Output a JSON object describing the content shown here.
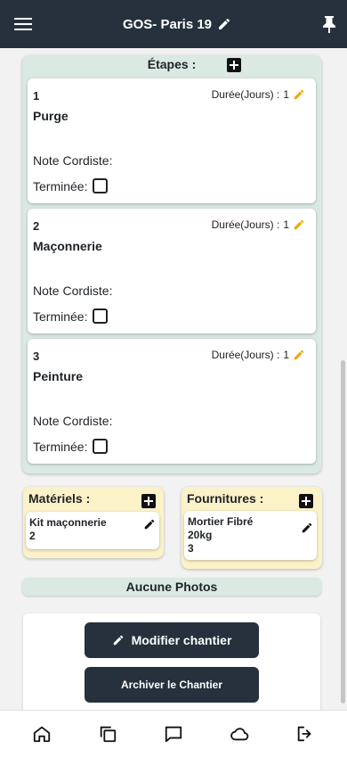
{
  "header": {
    "title": "GOS- Paris 19"
  },
  "etapes": {
    "title": "Étapes :",
    "duration_label": "Durée(Jours) :",
    "note_label": "Note Cordiste:",
    "done_label": "Terminée:",
    "steps": [
      {
        "number": "1",
        "name": "Purge",
        "duration": "1",
        "done": false
      },
      {
        "number": "2",
        "name": "Maçonnerie",
        "duration": "1",
        "done": false
      },
      {
        "number": "3",
        "name": "Peinture",
        "duration": "1",
        "done": false
      }
    ]
  },
  "materiels": {
    "title": "Matériels :",
    "items": [
      {
        "line1": "Kit maçonnerie",
        "line2": "2"
      }
    ]
  },
  "fournitures": {
    "title": "Fournitures :",
    "items": [
      {
        "line1": "Mortier Fibré",
        "line2": "20kg",
        "line3": "3"
      }
    ]
  },
  "photos": {
    "label": "Aucune Photos"
  },
  "actions": {
    "modify_label": "Modifier chantier",
    "archive_label": "Archiver le Chantier"
  },
  "colors": {
    "header_bg": "#26313d",
    "etapes_bg": "#dbe9e3",
    "materials_bg": "#fbf2c8",
    "edit_accent": "#f0a500"
  },
  "nav": {
    "items": [
      "home-icon",
      "copy-icon",
      "chat-icon",
      "cloud-icon",
      "logout-icon"
    ]
  }
}
